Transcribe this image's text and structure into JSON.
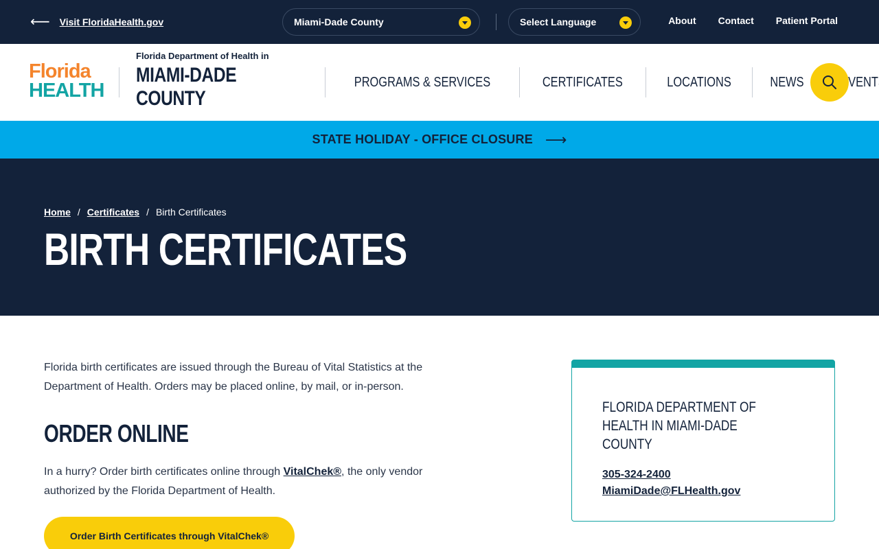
{
  "utility": {
    "back_label": "Visit FloridaHealth.gov",
    "county_select": "Miami-Dade County",
    "language_select": "Select Language",
    "links": [
      "About",
      "Contact",
      "Patient Portal"
    ]
  },
  "header": {
    "logo_line1": "Florida",
    "logo_line2": "HEALTH",
    "dept_top": "Florida Department of Health in",
    "dept_name": "MIAMI-DADE COUNTY",
    "nav": [
      "PROGRAMS & SERVICES",
      "CERTIFICATES",
      "LOCATIONS",
      "NEWS",
      "EVENTS"
    ]
  },
  "alert": {
    "text": "STATE HOLIDAY - OFFICE CLOSURE"
  },
  "hero": {
    "breadcrumb": [
      "Home",
      "Certificates",
      "Birth Certificates"
    ],
    "title": "BIRTH CERTIFICATES"
  },
  "content": {
    "intro": "Florida birth certificates are issued through the Bureau of Vital Statistics at the Department of Health. Orders may be placed online, by mail, or in-person.",
    "heading": "ORDER ONLINE",
    "online_before": "In a hurry? Order birth certificates online through ",
    "online_link": "VitalChek®",
    "online_after": ", the only vendor authorized by the Florida Department of Health.",
    "cta": "Order Birth Certificates through VitalChek®"
  },
  "card": {
    "title": "FLORIDA DEPARTMENT OF HEALTH IN MIAMI-DADE COUNTY",
    "phone": "305-324-2400",
    "email": "MiamiDade@FLHealth.gov"
  },
  "colors": {
    "navy": "#13223a",
    "alert_blue": "#00a9e8",
    "accent_yellow": "#f9cd0a",
    "teal": "#13a4a4",
    "orange": "#f4842c"
  }
}
